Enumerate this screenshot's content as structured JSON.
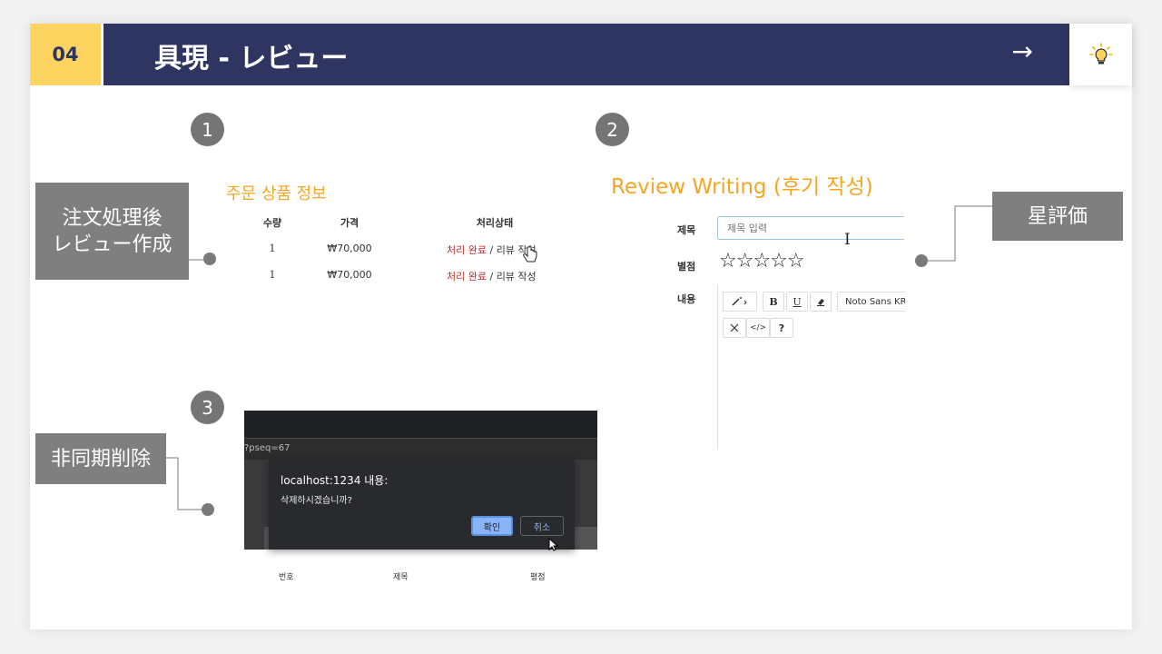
{
  "header": {
    "section_number": "04",
    "title": "具現 - レビュー",
    "arrow": "→"
  },
  "markers": {
    "one": "1",
    "two": "2",
    "three": "3"
  },
  "callouts": {
    "order_review": "注文処理後\nレビュー作成",
    "star_rating": "星評価",
    "async_delete": "非同期削除"
  },
  "order_panel": {
    "title": "주문 상품 정보",
    "columns": [
      "수량",
      "가격",
      "처리상태"
    ],
    "rows": [
      {
        "qty": "1",
        "price": "₩70,000",
        "status_done": "처리 완료",
        "sep": " / ",
        "status_action": "리뷰 작성"
      },
      {
        "qty": "1",
        "price": "₩70,000",
        "status_done": "처리 완료",
        "sep": " / ",
        "status_action": "리뷰 작성"
      }
    ]
  },
  "review_panel": {
    "title": "Review Writing (후기 작성)",
    "subject_label": "제목",
    "subject_placeholder": "제목 입력",
    "rating_label": "별점",
    "stars": "☆☆☆☆☆",
    "content_label": "내용",
    "toolbar": {
      "bold": "B",
      "underline": "U",
      "font": "Noto Sans KR",
      "code": "</>",
      "help": "?"
    }
  },
  "delete_panel": {
    "url_fragment": "?pseq=67",
    "dialog_title": "localhost:1234 내용:",
    "dialog_message": "삭제하시겠습니까?",
    "confirm_label": "확인",
    "cancel_label": "취소",
    "list_headers": [
      "번호",
      "제목",
      "평점"
    ]
  },
  "colors": {
    "navy": "#2e3561",
    "yellow": "#fcd45f",
    "orange": "#f5a623",
    "gray_label": "#7f7f7f"
  },
  "icons": [
    "lightbulb-icon",
    "arrow-right-icon",
    "magic-wand-icon",
    "eraser-icon",
    "fullscreen-icon",
    "hand-cursor-icon",
    "mouse-pointer-icon",
    "text-cursor-icon"
  ]
}
